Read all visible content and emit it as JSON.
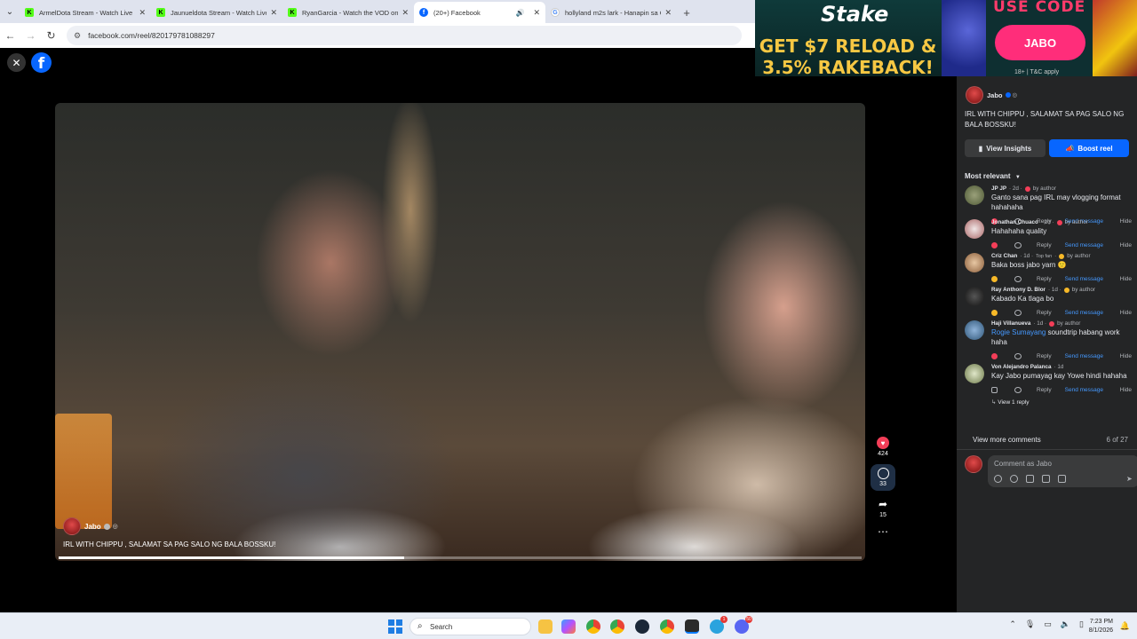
{
  "browser": {
    "tabs": [
      {
        "title": "ArmelDota Stream - Watch Live",
        "favicon": "kick-icon",
        "active": false
      },
      {
        "title": "Jaunueldota Stream - Watch Live",
        "favicon": "kick-icon",
        "active": false
      },
      {
        "title": "RyanGarcia - Watch the VOD on Kick",
        "favicon": "kick-icon",
        "active": false
      },
      {
        "title": "(20+) Facebook",
        "favicon": "facebook-icon",
        "active": true
      },
      {
        "title": "hollyland m2s lark - Hanapin sa Google",
        "favicon": "google-icon",
        "active": false
      }
    ],
    "url": "facebook.com/reel/820179781088297"
  },
  "ad": {
    "brand": "Stake",
    "headline_1": "GET $7 RELOAD &",
    "headline_2": "3.5% RAKEBACK!",
    "use_code_label": "USE CODE",
    "code": "JABO",
    "terms": "18+ | T&C apply"
  },
  "reel": {
    "owner_name": "Jabo",
    "caption": "IRL WITH CHIPPU , SALAMAT SA PAG SALO NG BALA BOSSKU!",
    "progress": 0.43,
    "likes": "424",
    "comments": "33",
    "shares": "15"
  },
  "panel": {
    "owner_name": "Jabo",
    "post_text": "IRL WITH CHIPPU , SALAMAT SA PAG SALO NG BALA BOSSKU!",
    "view_insights": "View Insights",
    "boost_reel": "Boost reel",
    "sort_label": "Most relevant",
    "reply_label": "Reply",
    "send_label": "Send message",
    "hide_label": "Hide",
    "view_more": "View more comments",
    "count": "6 of 27",
    "compose_placeholder": "Comment as Jabo",
    "comments": [
      {
        "author": "JP JP",
        "time": "2d",
        "by_author": "by author",
        "text": "Ganto sana pag IRL may vlogging format hahahaha",
        "reaction": "heart"
      },
      {
        "author": "Jonathan Chuaco",
        "time": "1d",
        "by_author": "by author",
        "text": "Hahahaha quality",
        "reaction": "heart"
      },
      {
        "author": "Criz Chan",
        "time": "1d",
        "tag": "Top fan",
        "by_author": "by author",
        "text": "Baka boss jabo yarn 🙂",
        "reaction": "haha"
      },
      {
        "author": "Ray Anthony D. Blor",
        "time": "1d",
        "by_author": "by author",
        "text": "Kabado Ka tlaga bo",
        "reaction": "haha"
      },
      {
        "author": "Haji Villanueva",
        "time": "1d",
        "by_author": "by author",
        "mention": "Rogie Sumayang",
        "text": "soundtrip habang work haha",
        "reaction": "heart"
      },
      {
        "author": "Von Alejandro Palanca",
        "time": "1d",
        "text": "Kay Jabo pumayag kay Yowe hindi hahaha",
        "reaction": "thumb",
        "view_reply": "View 1 reply"
      }
    ]
  },
  "taskbar": {
    "search_label": "Search",
    "time": "7:23 PM",
    "date": "8/1/2026",
    "badges": {
      "telegram": "1",
      "discord": "50"
    }
  }
}
